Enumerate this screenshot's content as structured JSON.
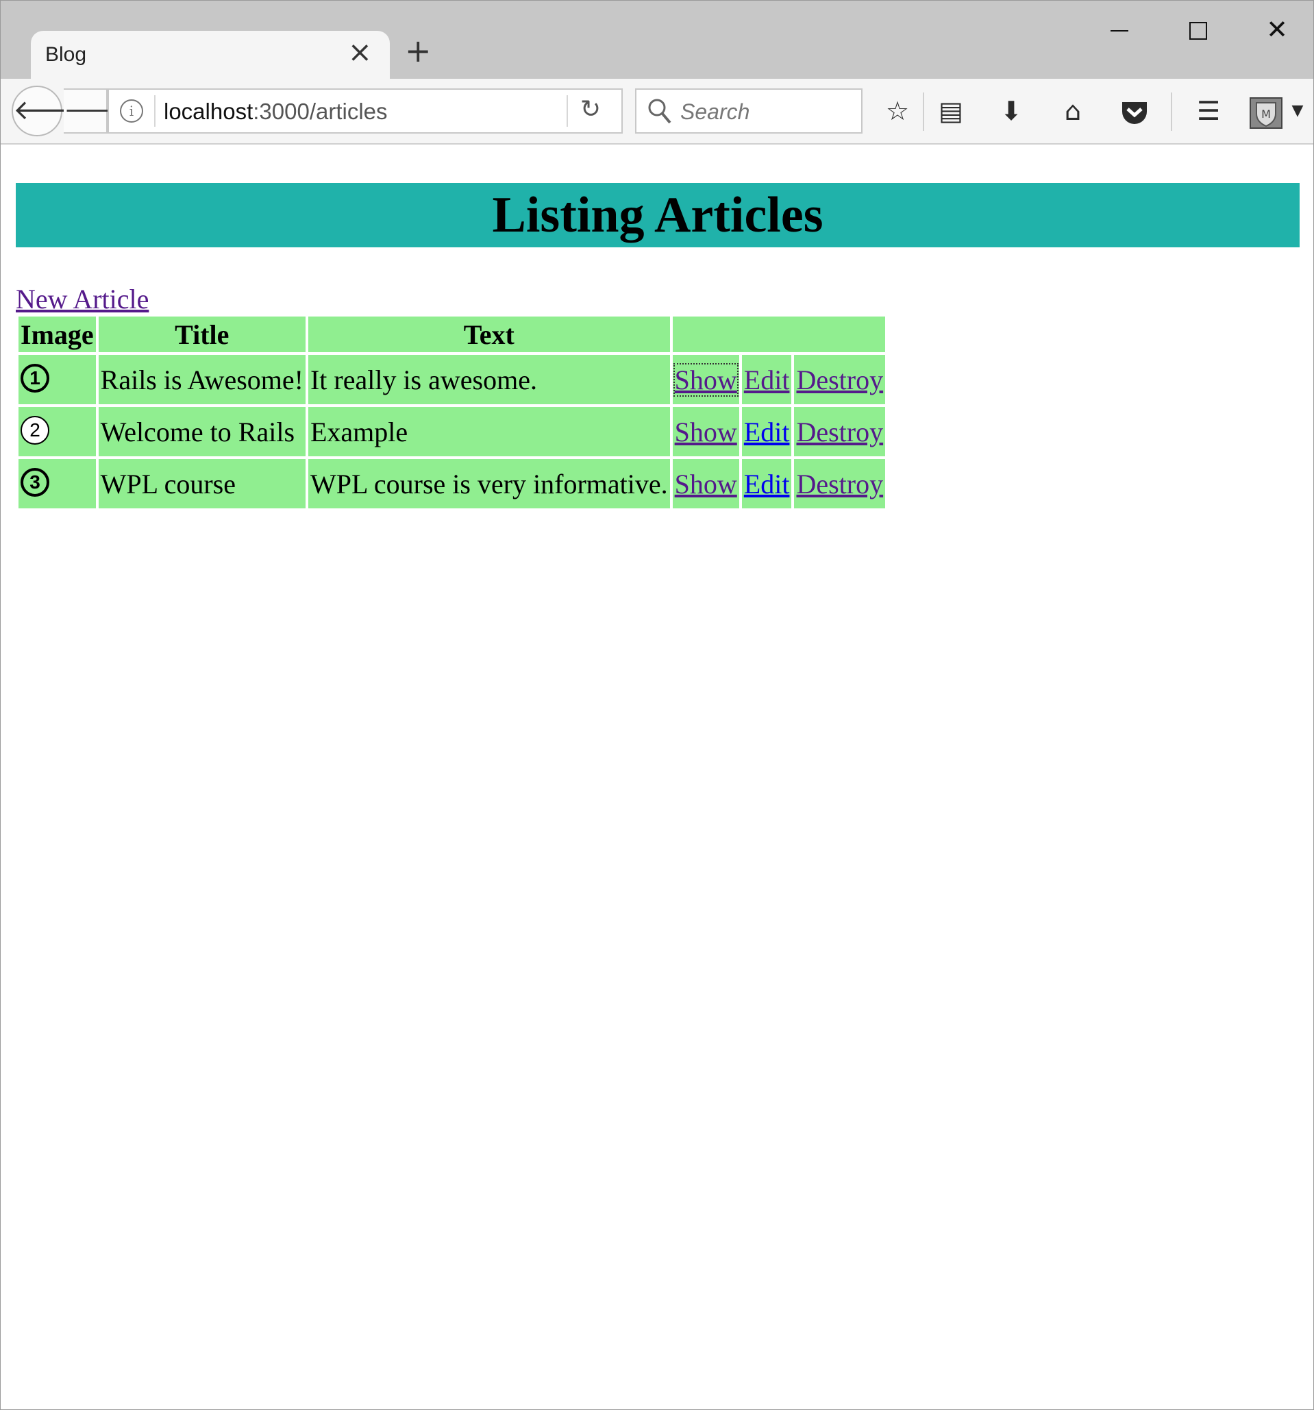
{
  "browser": {
    "tab_title": "Blog",
    "url_host": "localhost",
    "url_path": ":3000/articles",
    "search_placeholder": "Search"
  },
  "page": {
    "title": "Listing Articles",
    "new_article_label": "New Article"
  },
  "table": {
    "headers": [
      "Image",
      "Title",
      "Text",
      ""
    ],
    "rows": [
      {
        "image": "1",
        "title": "Rails is Awesome!",
        "text": "It really is awesome.",
        "show": "Show",
        "edit": "Edit",
        "destroy": "Destroy"
      },
      {
        "image": "2",
        "title": "Welcome to Rails",
        "text": "Example",
        "show": "Show",
        "edit": "Edit",
        "destroy": "Destroy"
      },
      {
        "image": "3",
        "title": "WPL course",
        "text": "WPL course is very informative.",
        "show": "Show",
        "edit": "Edit",
        "destroy": "Destroy"
      }
    ]
  },
  "colors": {
    "header_bg": "#20b2aa",
    "table_cell_bg": "#90ee90",
    "visited_link": "#551a8b",
    "unvisited_link": "#0000ee"
  },
  "icons": {
    "close_tab": "close-icon",
    "new_tab": "plus-icon",
    "back": "back-arrow-icon",
    "forward": "forward-arrow-icon",
    "info": "info-icon",
    "reload": "reload-icon",
    "search": "search-icon",
    "bookmark": "star-icon",
    "reading_list": "clipboard-icon",
    "downloads": "download-icon",
    "home": "home-icon",
    "pocket": "pocket-icon",
    "menu": "hamburger-menu-icon",
    "extension": "extension-shield-icon"
  }
}
